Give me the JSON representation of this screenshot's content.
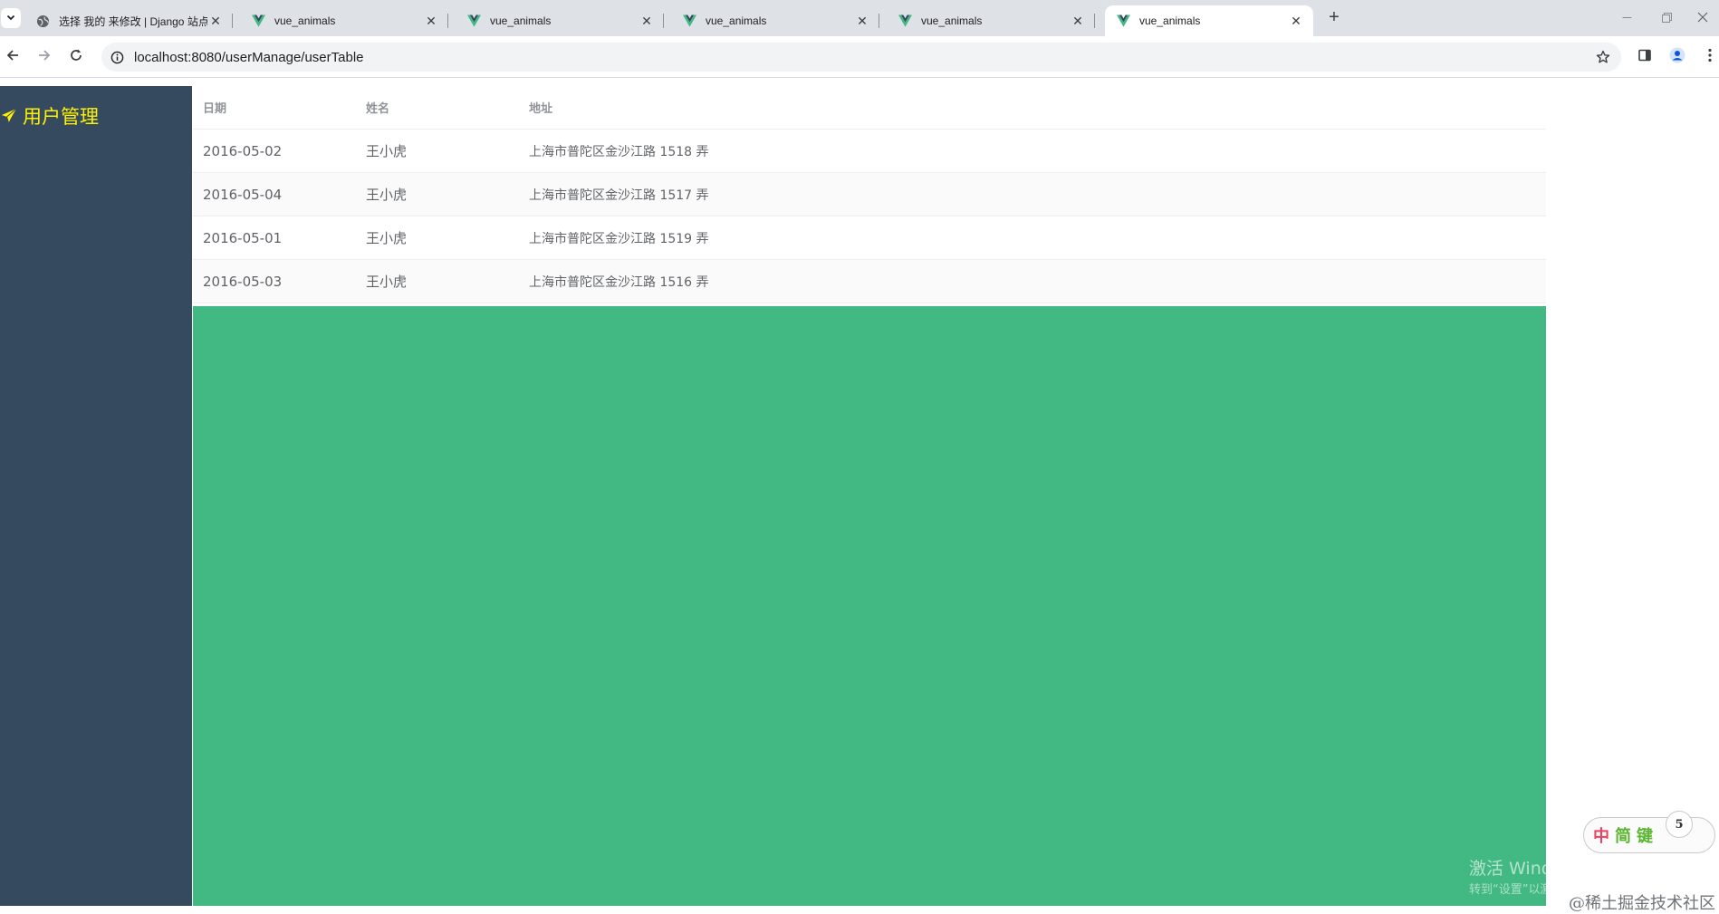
{
  "browser": {
    "tabs": [
      {
        "title": "选择 我的 来修改 | Django 站点管理",
        "favicon": "globe-icon",
        "active": false
      },
      {
        "title": "vue_animals",
        "favicon": "vue-logo-icon",
        "active": false
      },
      {
        "title": "vue_animals",
        "favicon": "vue-logo-icon",
        "active": false
      },
      {
        "title": "vue_animals",
        "favicon": "vue-logo-icon",
        "active": false
      },
      {
        "title": "vue_animals",
        "favicon": "vue-logo-icon",
        "active": false
      },
      {
        "title": "vue_animals",
        "favicon": "vue-logo-icon",
        "active": true
      }
    ],
    "url": "localhost:8080/userManage/userTable",
    "accent_color": "#42b983"
  },
  "sidebar": {
    "title": "用户管理",
    "title_icon": "paper-plane-icon",
    "background": "#354a5f",
    "title_color": "#fff200"
  },
  "table": {
    "headers": {
      "date": "日期",
      "name": "姓名",
      "address": "地址"
    },
    "rows": [
      {
        "date": "2016-05-02",
        "name": "王小虎",
        "address": "上海市普陀区金沙江路 1518 弄"
      },
      {
        "date": "2016-05-04",
        "name": "王小虎",
        "address": "上海市普陀区金沙江路 1517 弄"
      },
      {
        "date": "2016-05-01",
        "name": "王小虎",
        "address": "上海市普陀区金沙江路 1519 弄"
      },
      {
        "date": "2016-05-03",
        "name": "王小虎",
        "address": "上海市普陀区金沙江路 1516 弄"
      }
    ]
  },
  "overlays": {
    "activation_title": "激活 Windows",
    "activation_sub": "转到“设置”以激活 Windows。",
    "ime_chars": [
      "中",
      "简",
      "键"
    ],
    "ime_badge": "5",
    "credit": "@稀土掘金技术社区"
  }
}
